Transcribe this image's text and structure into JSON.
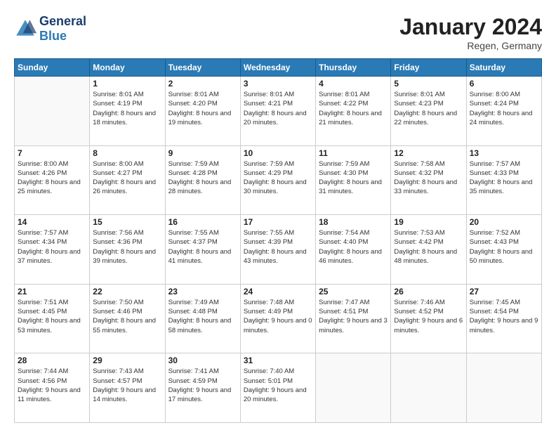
{
  "header": {
    "logo_line1": "General",
    "logo_line2": "Blue",
    "month_year": "January 2024",
    "location": "Regen, Germany"
  },
  "weekdays": [
    "Sunday",
    "Monday",
    "Tuesday",
    "Wednesday",
    "Thursday",
    "Friday",
    "Saturday"
  ],
  "rows": [
    [
      {
        "day": "",
        "sunrise": "",
        "sunset": "",
        "daylight": ""
      },
      {
        "day": "1",
        "sunrise": "Sunrise: 8:01 AM",
        "sunset": "Sunset: 4:19 PM",
        "daylight": "Daylight: 8 hours and 18 minutes."
      },
      {
        "day": "2",
        "sunrise": "Sunrise: 8:01 AM",
        "sunset": "Sunset: 4:20 PM",
        "daylight": "Daylight: 8 hours and 19 minutes."
      },
      {
        "day": "3",
        "sunrise": "Sunrise: 8:01 AM",
        "sunset": "Sunset: 4:21 PM",
        "daylight": "Daylight: 8 hours and 20 minutes."
      },
      {
        "day": "4",
        "sunrise": "Sunrise: 8:01 AM",
        "sunset": "Sunset: 4:22 PM",
        "daylight": "Daylight: 8 hours and 21 minutes."
      },
      {
        "day": "5",
        "sunrise": "Sunrise: 8:01 AM",
        "sunset": "Sunset: 4:23 PM",
        "daylight": "Daylight: 8 hours and 22 minutes."
      },
      {
        "day": "6",
        "sunrise": "Sunrise: 8:00 AM",
        "sunset": "Sunset: 4:24 PM",
        "daylight": "Daylight: 8 hours and 24 minutes."
      }
    ],
    [
      {
        "day": "7",
        "sunrise": "Sunrise: 8:00 AM",
        "sunset": "Sunset: 4:26 PM",
        "daylight": "Daylight: 8 hours and 25 minutes."
      },
      {
        "day": "8",
        "sunrise": "Sunrise: 8:00 AM",
        "sunset": "Sunset: 4:27 PM",
        "daylight": "Daylight: 8 hours and 26 minutes."
      },
      {
        "day": "9",
        "sunrise": "Sunrise: 7:59 AM",
        "sunset": "Sunset: 4:28 PM",
        "daylight": "Daylight: 8 hours and 28 minutes."
      },
      {
        "day": "10",
        "sunrise": "Sunrise: 7:59 AM",
        "sunset": "Sunset: 4:29 PM",
        "daylight": "Daylight: 8 hours and 30 minutes."
      },
      {
        "day": "11",
        "sunrise": "Sunrise: 7:59 AM",
        "sunset": "Sunset: 4:30 PM",
        "daylight": "Daylight: 8 hours and 31 minutes."
      },
      {
        "day": "12",
        "sunrise": "Sunrise: 7:58 AM",
        "sunset": "Sunset: 4:32 PM",
        "daylight": "Daylight: 8 hours and 33 minutes."
      },
      {
        "day": "13",
        "sunrise": "Sunrise: 7:57 AM",
        "sunset": "Sunset: 4:33 PM",
        "daylight": "Daylight: 8 hours and 35 minutes."
      }
    ],
    [
      {
        "day": "14",
        "sunrise": "Sunrise: 7:57 AM",
        "sunset": "Sunset: 4:34 PM",
        "daylight": "Daylight: 8 hours and 37 minutes."
      },
      {
        "day": "15",
        "sunrise": "Sunrise: 7:56 AM",
        "sunset": "Sunset: 4:36 PM",
        "daylight": "Daylight: 8 hours and 39 minutes."
      },
      {
        "day": "16",
        "sunrise": "Sunrise: 7:55 AM",
        "sunset": "Sunset: 4:37 PM",
        "daylight": "Daylight: 8 hours and 41 minutes."
      },
      {
        "day": "17",
        "sunrise": "Sunrise: 7:55 AM",
        "sunset": "Sunset: 4:39 PM",
        "daylight": "Daylight: 8 hours and 43 minutes."
      },
      {
        "day": "18",
        "sunrise": "Sunrise: 7:54 AM",
        "sunset": "Sunset: 4:40 PM",
        "daylight": "Daylight: 8 hours and 46 minutes."
      },
      {
        "day": "19",
        "sunrise": "Sunrise: 7:53 AM",
        "sunset": "Sunset: 4:42 PM",
        "daylight": "Daylight: 8 hours and 48 minutes."
      },
      {
        "day": "20",
        "sunrise": "Sunrise: 7:52 AM",
        "sunset": "Sunset: 4:43 PM",
        "daylight": "Daylight: 8 hours and 50 minutes."
      }
    ],
    [
      {
        "day": "21",
        "sunrise": "Sunrise: 7:51 AM",
        "sunset": "Sunset: 4:45 PM",
        "daylight": "Daylight: 8 hours and 53 minutes."
      },
      {
        "day": "22",
        "sunrise": "Sunrise: 7:50 AM",
        "sunset": "Sunset: 4:46 PM",
        "daylight": "Daylight: 8 hours and 55 minutes."
      },
      {
        "day": "23",
        "sunrise": "Sunrise: 7:49 AM",
        "sunset": "Sunset: 4:48 PM",
        "daylight": "Daylight: 8 hours and 58 minutes."
      },
      {
        "day": "24",
        "sunrise": "Sunrise: 7:48 AM",
        "sunset": "Sunset: 4:49 PM",
        "daylight": "Daylight: 9 hours and 0 minutes."
      },
      {
        "day": "25",
        "sunrise": "Sunrise: 7:47 AM",
        "sunset": "Sunset: 4:51 PM",
        "daylight": "Daylight: 9 hours and 3 minutes."
      },
      {
        "day": "26",
        "sunrise": "Sunrise: 7:46 AM",
        "sunset": "Sunset: 4:52 PM",
        "daylight": "Daylight: 9 hours and 6 minutes."
      },
      {
        "day": "27",
        "sunrise": "Sunrise: 7:45 AM",
        "sunset": "Sunset: 4:54 PM",
        "daylight": "Daylight: 9 hours and 9 minutes."
      }
    ],
    [
      {
        "day": "28",
        "sunrise": "Sunrise: 7:44 AM",
        "sunset": "Sunset: 4:56 PM",
        "daylight": "Daylight: 9 hours and 11 minutes."
      },
      {
        "day": "29",
        "sunrise": "Sunrise: 7:43 AM",
        "sunset": "Sunset: 4:57 PM",
        "daylight": "Daylight: 9 hours and 14 minutes."
      },
      {
        "day": "30",
        "sunrise": "Sunrise: 7:41 AM",
        "sunset": "Sunset: 4:59 PM",
        "daylight": "Daylight: 9 hours and 17 minutes."
      },
      {
        "day": "31",
        "sunrise": "Sunrise: 7:40 AM",
        "sunset": "Sunset: 5:01 PM",
        "daylight": "Daylight: 9 hours and 20 minutes."
      },
      {
        "day": "",
        "sunrise": "",
        "sunset": "",
        "daylight": ""
      },
      {
        "day": "",
        "sunrise": "",
        "sunset": "",
        "daylight": ""
      },
      {
        "day": "",
        "sunrise": "",
        "sunset": "",
        "daylight": ""
      }
    ]
  ]
}
